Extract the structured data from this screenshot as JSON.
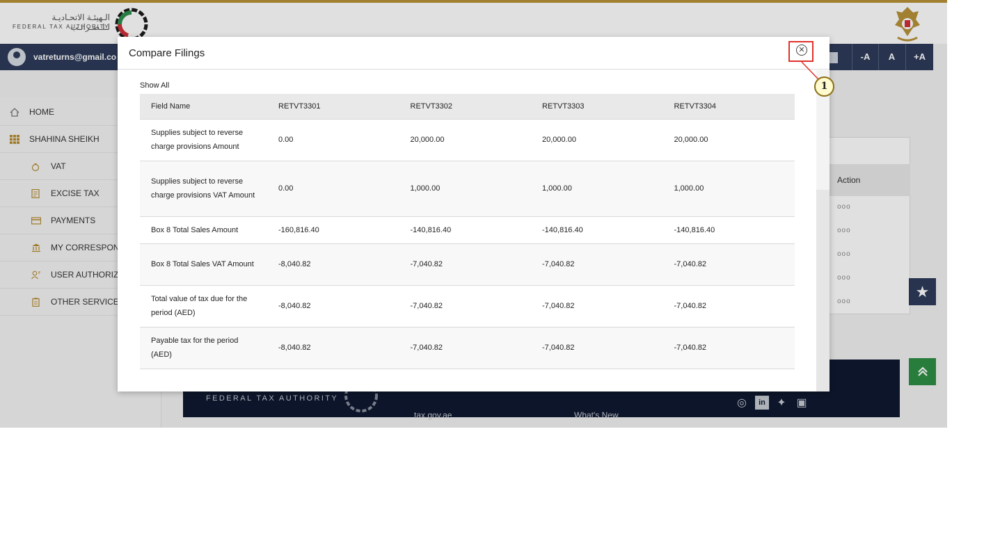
{
  "header": {
    "logo_arabic": "الـهيئـة الاتحـاديـة لـلـضـرائـب",
    "logo_english": "FEDERAL TAX AUTHORITY"
  },
  "userbar": {
    "email": "vatreturns@gmail.co",
    "font_buttons": [
      "-A",
      "A",
      "+A"
    ]
  },
  "sidebar": {
    "items": [
      {
        "label": "HOME",
        "icon": "home-icon"
      },
      {
        "label": "SHAHINA SHEIKH",
        "icon": "grid-icon"
      },
      {
        "label": "VAT",
        "icon": "money-bag-icon"
      },
      {
        "label": "EXCISE TAX",
        "icon": "receipt-icon"
      },
      {
        "label": "PAYMENTS",
        "icon": "card-icon"
      },
      {
        "label": "MY CORRESPON",
        "icon": "bank-icon"
      },
      {
        "label": "USER AUTHORIZ",
        "icon": "user-key-icon"
      },
      {
        "label": "OTHER SERVICE",
        "icon": "clipboard-icon"
      }
    ]
  },
  "background_table": {
    "action_header": "Action",
    "row_action": "ooo"
  },
  "footer": {
    "brand": "FEDERAL TAX AUTHORITY",
    "links": [
      "tax.gov.ae",
      "What's New"
    ]
  },
  "modal": {
    "title": "Compare Filings",
    "show_all": "Show All",
    "close_icon": "close-circle-icon",
    "table": {
      "headers": [
        "Field Name",
        "RETVT3301",
        "RETVT3302",
        "RETVT3303",
        "RETVT3304"
      ],
      "rows": [
        [
          "Supplies subject to reverse charge provisions Amount",
          "0.00",
          "20,000.00",
          "20,000.00",
          "20,000.00"
        ],
        [
          "Supplies subject to reverse charge provisions VAT Amount",
          "0.00",
          "1,000.00",
          "1,000.00",
          "1,000.00"
        ],
        [
          "Box 8 Total Sales Amount",
          "-160,816.40",
          "-140,816.40",
          "-140,816.40",
          "-140,816.40"
        ],
        [
          "Box 8 Total Sales VAT Amount",
          "-8,040.82",
          "-7,040.82",
          "-7,040.82",
          "-7,040.82"
        ],
        [
          "Total value of tax due for the period (AED)",
          "-8,040.82",
          "-7,040.82",
          "-7,040.82",
          "-7,040.82"
        ],
        [
          "Payable tax for the period (AED)",
          "-8,040.82",
          "-7,040.82",
          "-7,040.82",
          "-7,040.82"
        ]
      ]
    }
  },
  "annotation": {
    "marker_label": "1",
    "color": "#e0302a"
  }
}
